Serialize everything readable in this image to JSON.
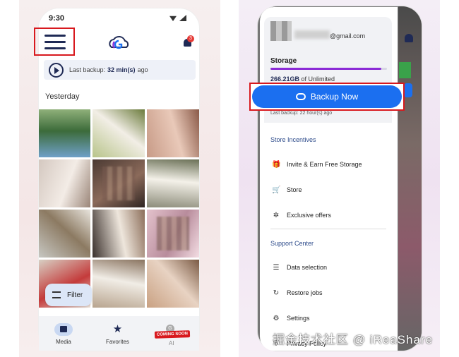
{
  "left": {
    "time": "9:30",
    "bell_badge": "3",
    "last_backup": {
      "prefix": "Last backup:",
      "value": "32 min(s)",
      "suffix": "ago"
    },
    "section": "Yesterday",
    "filter_label": "Filter",
    "nav": {
      "media": "Media",
      "favorites": "Favorites",
      "ai": "AI",
      "coming_soon": "COMING SOON",
      "ai_icon": "G"
    },
    "photos": [
      {
        "desc": "mountain-photo",
        "colors": [
          "#6fa0c8",
          "#3c6b3a",
          "#8fb07a"
        ]
      },
      {
        "desc": "bride-photo",
        "colors": [
          "#b8c48a",
          "#f2eee6",
          "#6b7b3c"
        ]
      },
      {
        "desc": "ring-hands-photo",
        "colors": [
          "#c79a86",
          "#e9c9b9",
          "#8a5a48"
        ]
      },
      {
        "desc": "couple-hands-photo",
        "colors": [
          "#d4c8c0",
          "#f3ece6",
          "#9a8578"
        ]
      },
      {
        "desc": "blurred-photo",
        "colors": [
          "#4b3a33",
          "#8b6a5a",
          "#2f2522"
        ]
      },
      {
        "desc": "cake-photo",
        "colors": [
          "#8c8c7a",
          "#f4f1e9",
          "#6a7056"
        ]
      },
      {
        "desc": "banquet-photo",
        "colors": [
          "#c7c7c2",
          "#8c7a62",
          "#e8e4dd"
        ]
      },
      {
        "desc": "table-flowers-photo",
        "colors": [
          "#3a302c",
          "#eee6dc",
          "#8c6e5a"
        ]
      },
      {
        "desc": "blurred-pink-photo",
        "colors": [
          "#e3c2cc",
          "#b88c9c",
          "#f3dde3"
        ]
      },
      {
        "desc": "red-flowers-photo",
        "colors": [
          "#d8d0c4",
          "#c43b3b",
          "#ece5dc"
        ]
      },
      {
        "desc": "frame-photo",
        "colors": [
          "#b8a48e",
          "#f1ede6",
          "#8a7460"
        ]
      },
      {
        "desc": "wedding-car-photo",
        "colors": [
          "#c9a182",
          "#e8d3c3",
          "#7a5a44"
        ]
      }
    ]
  },
  "right": {
    "email": "@gmail.com",
    "storage": {
      "title": "Storage",
      "used": "266.21GB",
      "of": "of Unlimited",
      "fill": 0.95
    },
    "backup_now": "Backup Now",
    "last_backup": "Last backup: 22 hour(s) ago",
    "store_incentives": "Store Incentives",
    "items1": [
      {
        "label": "Invite & Earn Free Storage",
        "icon": "gift-icon"
      },
      {
        "label": "Store",
        "icon": "cart-icon"
      },
      {
        "label": "Exclusive offers",
        "icon": "star-offer-icon"
      }
    ],
    "support_center": "Support Center",
    "items2": [
      {
        "label": "Data selection",
        "icon": "checklist-icon"
      },
      {
        "label": "Restore jobs",
        "icon": "restore-icon"
      },
      {
        "label": "Settings",
        "icon": "gear-icon"
      },
      {
        "label": "Privacy Policy",
        "icon": "shield-icon"
      }
    ]
  },
  "watermark": "掘金技术社区 @ iReaShare",
  "colors": {
    "brand": "#1f2a55",
    "primary": "#1b6ff0",
    "highlight": "#d8191e",
    "progress": "#8b2bd6"
  }
}
